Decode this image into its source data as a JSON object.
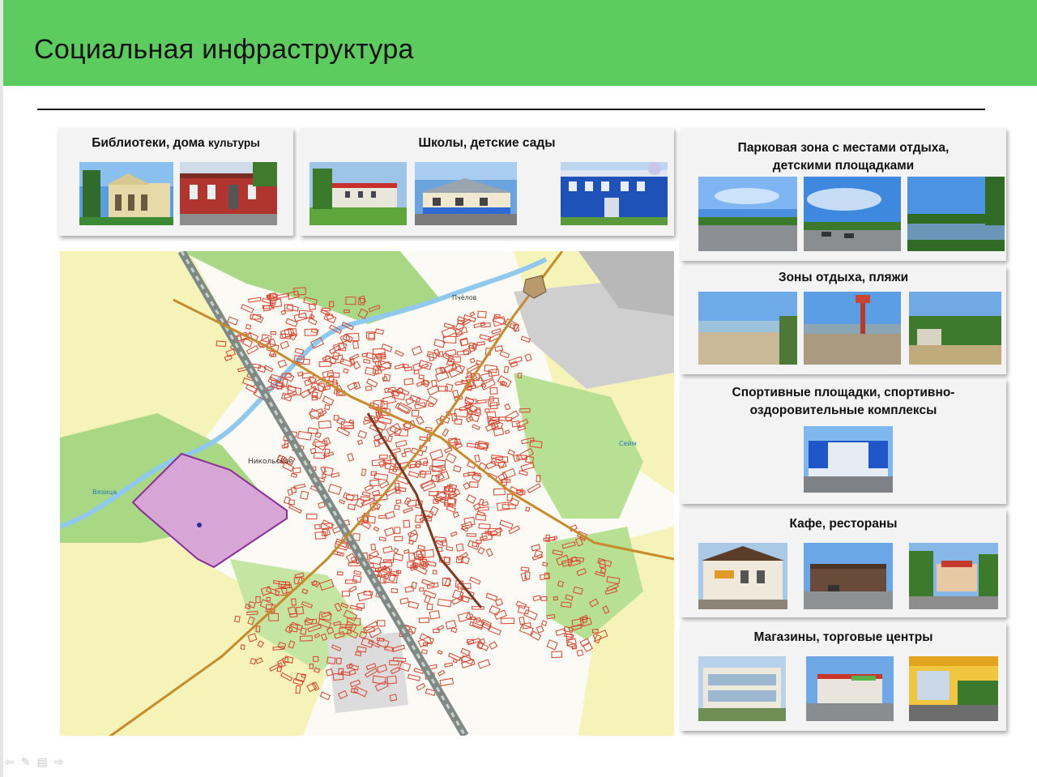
{
  "slide": {
    "title": "Социальная инфраструктура"
  },
  "cards": {
    "libraries": {
      "title_main": "Библиотеки, дома ",
      "title_small": "культуры"
    },
    "schools": {
      "title": "Школы, детские сады"
    },
    "parks": {
      "title_line1": "Парковая зона с местами отдыха,",
      "title_line2": "детскими площадками"
    },
    "beaches": {
      "title": "Зоны отдыха, пляжи"
    },
    "sports": {
      "title_line1": "Спортивные площадки, спортивно-",
      "title_line2": "оздоровительные комплексы"
    },
    "cafes": {
      "title": "Кафе, рестораны"
    },
    "shops": {
      "title": "Магазины, торговые центры"
    }
  },
  "map": {
    "labels": [
      "Никольское",
      "Пчёлов",
      "Сейм",
      "Вязица"
    ]
  },
  "colors": {
    "header_green": "#5ccc5e",
    "map_buildings": "#d9442e",
    "map_fields": "#f6f3b8",
    "map_forest": "#a8d883",
    "map_highlight": "#d7a6d6"
  },
  "nav_icons": [
    "back-arrow-icon",
    "pen-icon",
    "menu-icon",
    "forward-arrow-icon"
  ]
}
